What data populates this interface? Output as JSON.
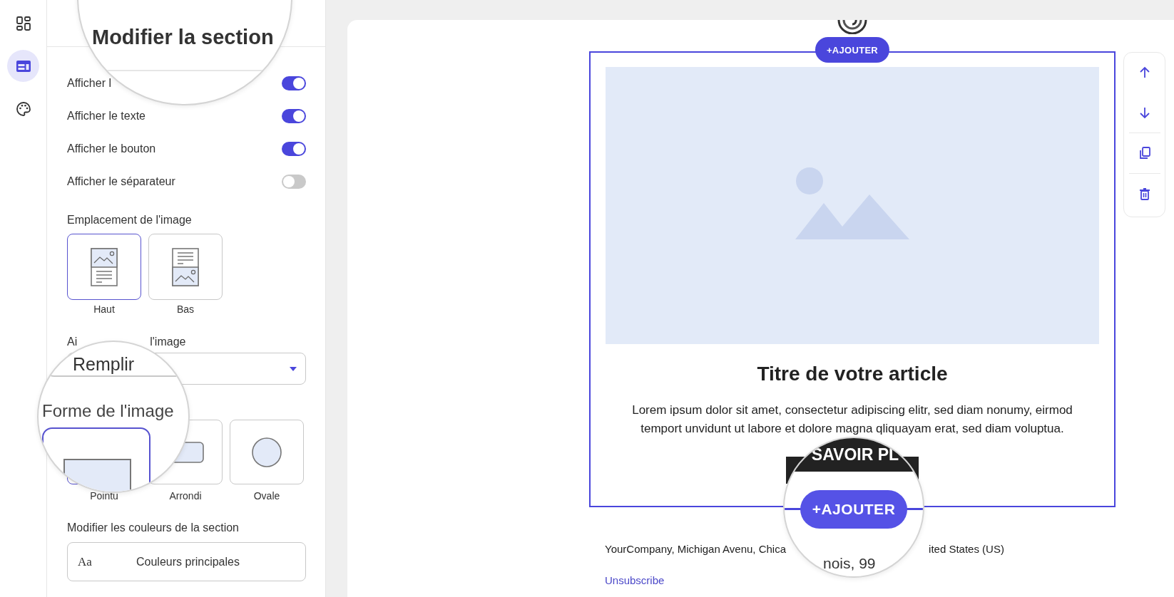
{
  "rail": [
    {
      "kind": "blocks",
      "selected": false
    },
    {
      "kind": "section",
      "selected": true
    },
    {
      "kind": "palette",
      "selected": false
    }
  ],
  "panel": {
    "header_zoom": {
      "title": "Modifier la section"
    },
    "toggles": [
      {
        "label": "Afficher l",
        "on": true
      },
      {
        "label": "Afficher le texte",
        "on": true
      },
      {
        "label": "Afficher le bouton",
        "on": true
      },
      {
        "label": "Afficher le séparateur",
        "on": false
      }
    ],
    "placement": {
      "label": "Emplacement de l'image",
      "options": [
        {
          "kind": "top",
          "label": "Haut",
          "selected": true
        },
        {
          "kind": "bottom",
          "label": "Bas",
          "selected": false
        }
      ]
    },
    "fit": {
      "label_parts": [
        "Ai",
        "l'image"
      ]
    },
    "fit_zoom": {
      "value": "Remplir",
      "next_label": "Forme de l'image"
    },
    "shapes": [
      {
        "kind": "sharp",
        "label": "Pointu",
        "selected": true
      },
      {
        "kind": "rounded",
        "label": "Arrondi",
        "selected": false
      },
      {
        "kind": "oval",
        "label": "Ovale",
        "selected": false
      }
    ],
    "colors": {
      "label": "Modifier les couleurs de la section",
      "sample": "Aa",
      "value": "Couleurs principales"
    }
  },
  "canvas": {
    "add_top": "+AJOUTER",
    "title": "Titre de votre article",
    "body": "Lorem ipsum dolor sit amet, consectetur adipiscing elitr, sed diam nonumy, eirmod temport unvidunt ut labore et dolore magna qliquayam erat, sed diam voluptua.",
    "footer_left": "YourCompany, Michigan Avenu, Chica",
    "footer_right": "ited States (US)",
    "unsubscribe": "Unsubscribe",
    "zoom": {
      "button": "SAVOIR PL",
      "add": "+AJOUTER",
      "footer": "nois, 99"
    }
  },
  "toolbar": [
    {
      "kind": "up"
    },
    {
      "kind": "down"
    },
    {
      "kind": "copy"
    },
    {
      "kind": "delete"
    }
  ]
}
